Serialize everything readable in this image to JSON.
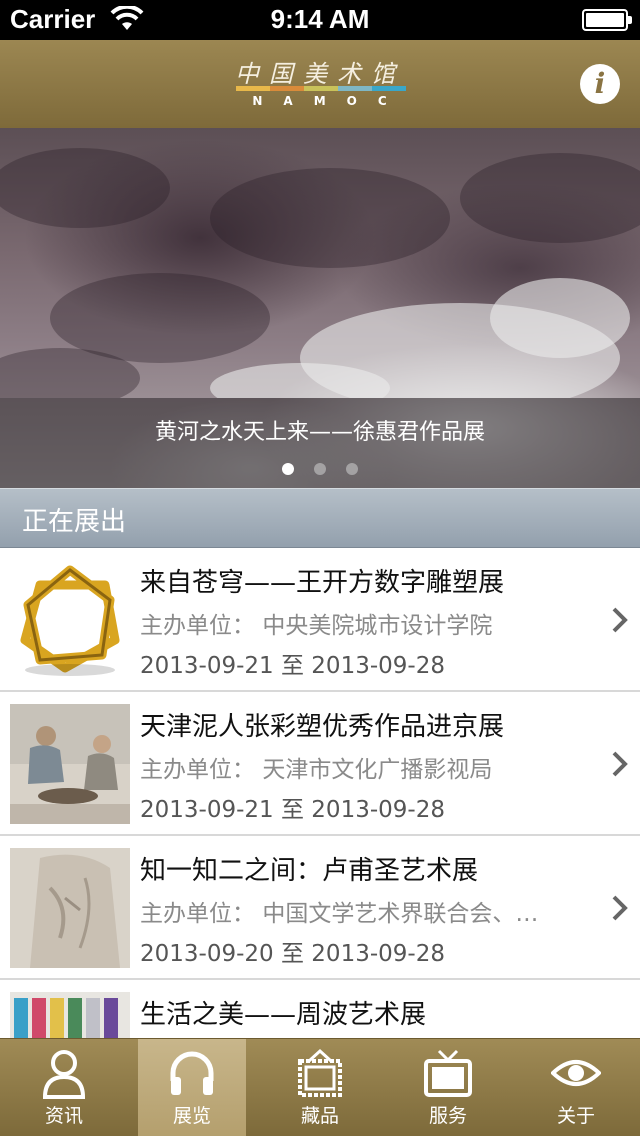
{
  "status_bar": {
    "carrier": "Carrier",
    "time": "9:14 AM"
  },
  "nav": {
    "logo_chars": "中国美术馆",
    "logo_text": "NAMOC",
    "info_label": "i"
  },
  "banner": {
    "caption": "黄河之水天上来——徐惠君作品展",
    "slide_count": 3,
    "active_slide": 1
  },
  "section": {
    "title": "正在展出"
  },
  "exhibitions": [
    {
      "title": "来自苍穹——王开方数字雕塑展",
      "org_label": "主办单位：",
      "org": "中央美院城市设计学院",
      "start": "2013-09-21",
      "sep": "至",
      "end": "2013-09-28"
    },
    {
      "title": "天津泥人张彩塑优秀作品进京展",
      "org_label": "主办单位：",
      "org": "天津市文化广播影视局",
      "start": "2013-09-21",
      "sep": "至",
      "end": "2013-09-28"
    },
    {
      "title": "知一知二之间：卢甫圣艺术展",
      "org_label": "主办单位：",
      "org": "中国文学艺术界联合会、…",
      "start": "2013-09-20",
      "sep": "至",
      "end": "2013-09-28"
    },
    {
      "title": "生活之美——周波艺术展",
      "org_label": "",
      "org": "",
      "start": "",
      "sep": "",
      "end": ""
    }
  ],
  "tabs": [
    {
      "label": "资讯",
      "icon": "person-icon"
    },
    {
      "label": "展览",
      "icon": "headphones-icon"
    },
    {
      "label": "藏品",
      "icon": "frame-icon"
    },
    {
      "label": "服务",
      "icon": "tv-icon"
    },
    {
      "label": "关于",
      "icon": "eye-icon"
    }
  ],
  "active_tab": 1,
  "colors": {
    "nav_gold": "#8e7a47",
    "section_blue": "#a4b0bb",
    "logo_stripe": [
      "#e8b84a",
      "#d98b3a",
      "#c9c25a",
      "#7fb7c4",
      "#3aa7c8"
    ]
  }
}
